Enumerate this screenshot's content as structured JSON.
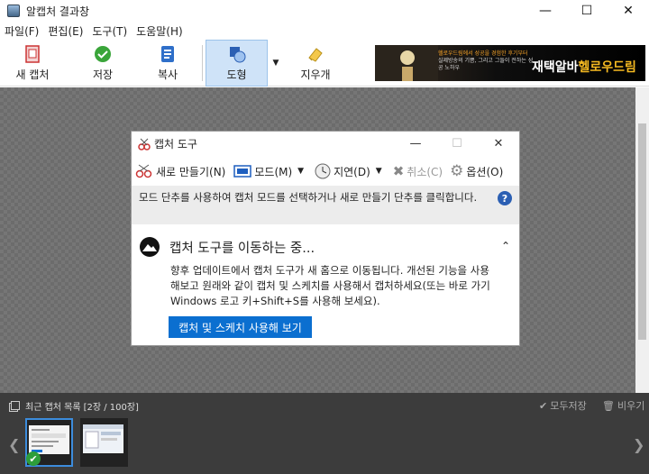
{
  "window": {
    "title": "알캡처 결과창"
  },
  "menu": [
    "파일(F)",
    "편집(E)",
    "도구(T)",
    "도움말(H)"
  ],
  "toolbar": {
    "new_capture": "새 캡처",
    "save": "저장",
    "copy": "복사",
    "shape": "도형",
    "eraser": "지우개"
  },
  "ad": {
    "line1": "헬로우드림에서 성공을 경험한 후기부터",
    "line2": "실제방송의 기쁨, 그리고 그들이 전하는 성공 노하우",
    "headline_a": "재택알바",
    "headline_b": "헬로우드림"
  },
  "snip": {
    "title": "캡처 도구",
    "new": "새로 만들기(N)",
    "mode": "모드(M)",
    "delay": "지연(D)",
    "cancel": "취소(C)",
    "options": "옵션(O)",
    "info": "모드 단추를 사용하여 캡처 모드를 선택하거나 새로 만들기 단추를 클릭합니다.",
    "moving_title": "캡처 도구를 이동하는 중...",
    "moving_body": "향후 업데이트에서 캡처 도구가 새 홈으로 이동됩니다. 개선된 기능을 사용해보고 원래와 같이 캡처 및 스케치를 사용해서 캡처하세요(또는 바로 가기 Windows 로고 키+Shift+S를 사용해 보세요).",
    "open_button": "캡처 및 스케치 사용해 보기"
  },
  "bottom": {
    "label": "최근 캡처 목록",
    "count": "[2장 / 100장]",
    "save_all": "모두저장",
    "clear": "비우기"
  },
  "colors": {
    "accent": "#0b6fd0",
    "bottom_bg": "#3c3c3c",
    "selected_border": "#3c8cdc"
  }
}
